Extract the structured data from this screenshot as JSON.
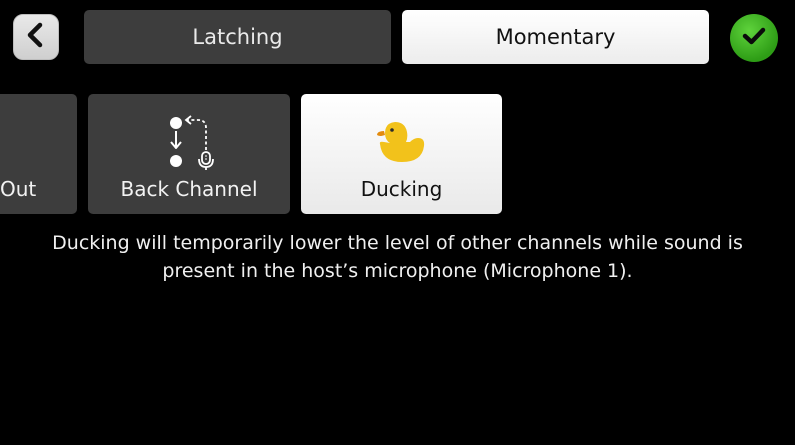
{
  "header": {
    "back_icon": "chevron-left-icon",
    "modes": [
      {
        "label": "Latching",
        "selected": false
      },
      {
        "label": "Momentary",
        "selected": true
      }
    ],
    "confirm_icon": "checkmark-icon",
    "confirm_color": "#3cb521"
  },
  "functions": [
    {
      "label": "Out",
      "icon": "",
      "selected": false
    },
    {
      "label": "Back Channel",
      "icon": "back-channel-icon",
      "selected": false
    },
    {
      "label": "Ducking",
      "icon": "duck-icon",
      "selected": true,
      "icon_color": "#f2c21b"
    }
  ],
  "description": {
    "line1": "Ducking will temporarily lower the level of other channels while sound is",
    "line2": "present in the host’s microphone (Microphone 1)."
  }
}
